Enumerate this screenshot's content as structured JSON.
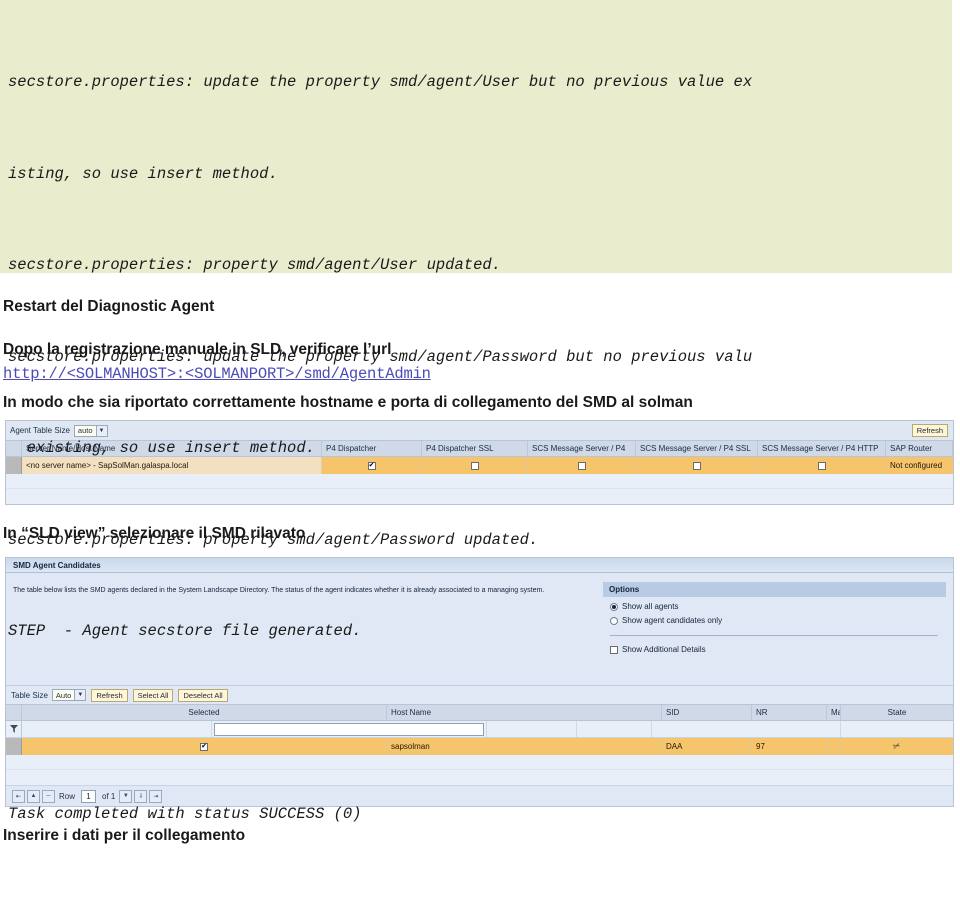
{
  "log": {
    "lines": [
      "secstore.properties: update the property smd/agent/User but no previous value ex",
      "isting, so use insert method.",
      "secstore.properties: property smd/agent/User updated.",
      "secstore.properties: update the property smd/agent/Password but no previous valu",
      "e existing, so use insert method.",
      "secstore.properties: property smd/agent/Password updated.",
      "STEP  - Agent secstore file generated.",
      "",
      "Task completed with status SUCCESS (0)"
    ]
  },
  "doc": {
    "heading_restart": "Restart del Diagnostic Agent",
    "para_sld": "Dopo la registrazione manuale in SLD, verificare l’url",
    "url": "http://<SOLMANHOST>:<SOLMANPORT>/smd/AgentAdmin",
    "para_hostname": "In modo che sia riportato correttamente hostname e porta di collegamento del SMD al solman",
    "para_sldview": "In “SLD view” selezionare il SMD rilavato",
    "para_insert": "Inserire i dati per il collegamento"
  },
  "agent_table": {
    "toolbar": {
      "size_label": "Agent Table Size",
      "size_value": "auto",
      "refresh_label": "Refresh"
    },
    "columns": [
      "Server Name/Host Name",
      "P4 Dispatcher",
      "P4 Dispatcher SSL",
      "SCS Message Server / P4",
      "SCS Message Server / P4 SSL",
      "SCS Message Server / P4 HTTP",
      "SAP Router"
    ],
    "row": {
      "server_name": "<no server name> - SapSolMan.galaspa.local",
      "p4_dispatcher": true,
      "p4_dispatcher_ssl": false,
      "scs_p4": false,
      "scs_p4_ssl": false,
      "scs_p4_http": false,
      "sap_router": "Not configured"
    }
  },
  "smd_panel": {
    "title": "SMD Agent Candidates",
    "description": "The table below lists the SMD agents declared in the System Landscape Directory. The status of the agent indicates whether it is already associated to a managing system.",
    "options": {
      "header": "Options",
      "radio_all": "Show all agents",
      "radio_candidates": "Show agent candidates only",
      "selected": "all",
      "checkbox_details": "Show Additional Details",
      "checkbox_details_checked": false
    },
    "toolbar": {
      "size_label": "Table Size",
      "size_value": "Auto",
      "refresh_label": "Refresh",
      "select_all_label": "Select All",
      "deselect_all_label": "Deselect All"
    },
    "columns": [
      "Selected",
      "Host Name",
      "SID",
      "NR",
      "Managing System",
      "State"
    ],
    "rows": [
      {
        "selected": true,
        "host_name": "sapsolman",
        "sid": "DAA",
        "nr": "97",
        "managing_system": "",
        "state_icon": "plug-icon"
      }
    ],
    "pager": {
      "row_label": "Row",
      "current": "1",
      "of_label": "of 1"
    }
  },
  "colors": {
    "log_bg": "#eaecce",
    "sap_bg": "#dfe8f4",
    "row_highlight": "#f5c46b",
    "link": "#4a4ab8"
  }
}
